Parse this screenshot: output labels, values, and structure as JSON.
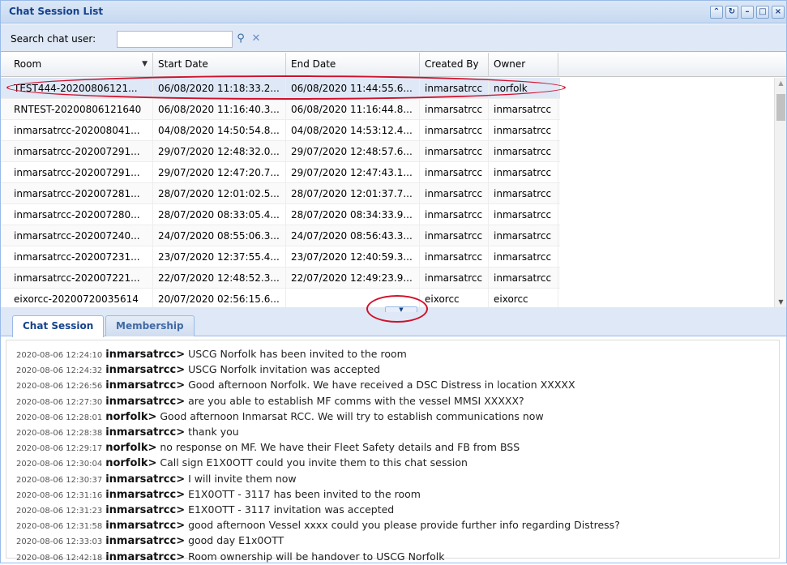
{
  "window": {
    "title": "Chat Session List",
    "tools": [
      "collapse-icon",
      "refresh-icon",
      "minimize-icon",
      "maximize-icon",
      "close-icon"
    ]
  },
  "search": {
    "label": "Search chat user:",
    "value": "",
    "placeholder": "",
    "search_icon": "search-icon",
    "clear_icon": "clear-icon"
  },
  "grid": {
    "columns": [
      "Room",
      "Start Date",
      "End Date",
      "Created By",
      "Owner"
    ],
    "rows": [
      [
        "TEST444-20200806121...",
        "06/08/2020 11:18:33.2...",
        "06/08/2020 11:44:55.6...",
        "inmarsatrcc",
        "norfolk"
      ],
      [
        "RNTEST-20200806121640",
        "06/08/2020 11:16:40.3...",
        "06/08/2020 11:16:44.8...",
        "inmarsatrcc",
        "inmarsatrcc"
      ],
      [
        "inmarsatrcc-202008041...",
        "04/08/2020 14:50:54.8...",
        "04/08/2020 14:53:12.4...",
        "inmarsatrcc",
        "inmarsatrcc"
      ],
      [
        "inmarsatrcc-202007291...",
        "29/07/2020 12:48:32.0...",
        "29/07/2020 12:48:57.6...",
        "inmarsatrcc",
        "inmarsatrcc"
      ],
      [
        "inmarsatrcc-202007291...",
        "29/07/2020 12:47:20.7...",
        "29/07/2020 12:47:43.1...",
        "inmarsatrcc",
        "inmarsatrcc"
      ],
      [
        "inmarsatrcc-202007281...",
        "28/07/2020 12:01:02.5...",
        "28/07/2020 12:01:37.7...",
        "inmarsatrcc",
        "inmarsatrcc"
      ],
      [
        "inmarsatrcc-202007280...",
        "28/07/2020 08:33:05.4...",
        "28/07/2020 08:34:33.9...",
        "inmarsatrcc",
        "inmarsatrcc"
      ],
      [
        "inmarsatrcc-202007240...",
        "24/07/2020 08:55:06.3...",
        "24/07/2020 08:56:43.3...",
        "inmarsatrcc",
        "inmarsatrcc"
      ],
      [
        "inmarsatrcc-202007231...",
        "23/07/2020 12:37:55.4...",
        "23/07/2020 12:40:59.3...",
        "inmarsatrcc",
        "inmarsatrcc"
      ],
      [
        "inmarsatrcc-202007221...",
        "22/07/2020 12:48:52.3...",
        "22/07/2020 12:49:23.9...",
        "inmarsatrcc",
        "inmarsatrcc"
      ],
      [
        "eixorcc-20200720035614",
        "20/07/2020 02:56:15.6...",
        "",
        "eixorcc",
        "eixorcc"
      ]
    ],
    "selected_row": 0
  },
  "tabs": [
    {
      "label": "Chat Session",
      "active": true
    },
    {
      "label": "Membership",
      "active": false
    }
  ],
  "chat": {
    "messages": [
      {
        "ts": "2020-08-06 12:24:10",
        "user": "inmarsatrcc>",
        "text": "USCG Norfolk has been invited to the room"
      },
      {
        "ts": "2020-08-06 12:24:32",
        "user": "inmarsatrcc>",
        "text": "USCG Norfolk invitation was accepted"
      },
      {
        "ts": "2020-08-06 12:26:56",
        "user": "inmarsatrcc>",
        "text": "Good afternoon Norfolk. We have received a DSC Distress in location XXXXX"
      },
      {
        "ts": "2020-08-06 12:27:30",
        "user": "inmarsatrcc>",
        "text": "are you able to establish MF comms with the vessel MMSI XXXXX?"
      },
      {
        "ts": "2020-08-06 12:28:01",
        "user": "norfolk>",
        "text": "Good afternoon Inmarsat RCC. We will try to establish communications now"
      },
      {
        "ts": "2020-08-06 12:28:38",
        "user": "inmarsatrcc>",
        "text": "thank you"
      },
      {
        "ts": "2020-08-06 12:29:17",
        "user": "norfolk>",
        "text": "no response on MF. We have their Fleet Safety details and FB from BSS"
      },
      {
        "ts": "2020-08-06 12:30:04",
        "user": "norfolk>",
        "text": "Call sign E1X0OTT could you invite them to this chat session"
      },
      {
        "ts": "2020-08-06 12:30:37",
        "user": "inmarsatrcc>",
        "text": "I will invite them now"
      },
      {
        "ts": "2020-08-06 12:31:16",
        "user": "inmarsatrcc>",
        "text": "E1X0OTT - 3117 has been invited to the room"
      },
      {
        "ts": "2020-08-06 12:31:23",
        "user": "inmarsatrcc>",
        "text": "E1X0OTT - 3117 invitation was accepted"
      },
      {
        "ts": "2020-08-06 12:31:58",
        "user": "inmarsatrcc>",
        "text": "good afternoon Vessel xxxx could you please provide further info regarding Distress?"
      },
      {
        "ts": "2020-08-06 12:33:03",
        "user": "inmarsatrcc>",
        "text": "good day E1x0OTT"
      },
      {
        "ts": "2020-08-06 12:42:18",
        "user": "inmarsatrcc>",
        "text": "Room ownership will be handover to USCG Norfolk"
      }
    ]
  },
  "colors": {
    "title_text": "#15428b",
    "panel_border": "#99bbe8",
    "toolbar_bg": "#dfe8f6",
    "annotation_red": "#d0112b"
  }
}
